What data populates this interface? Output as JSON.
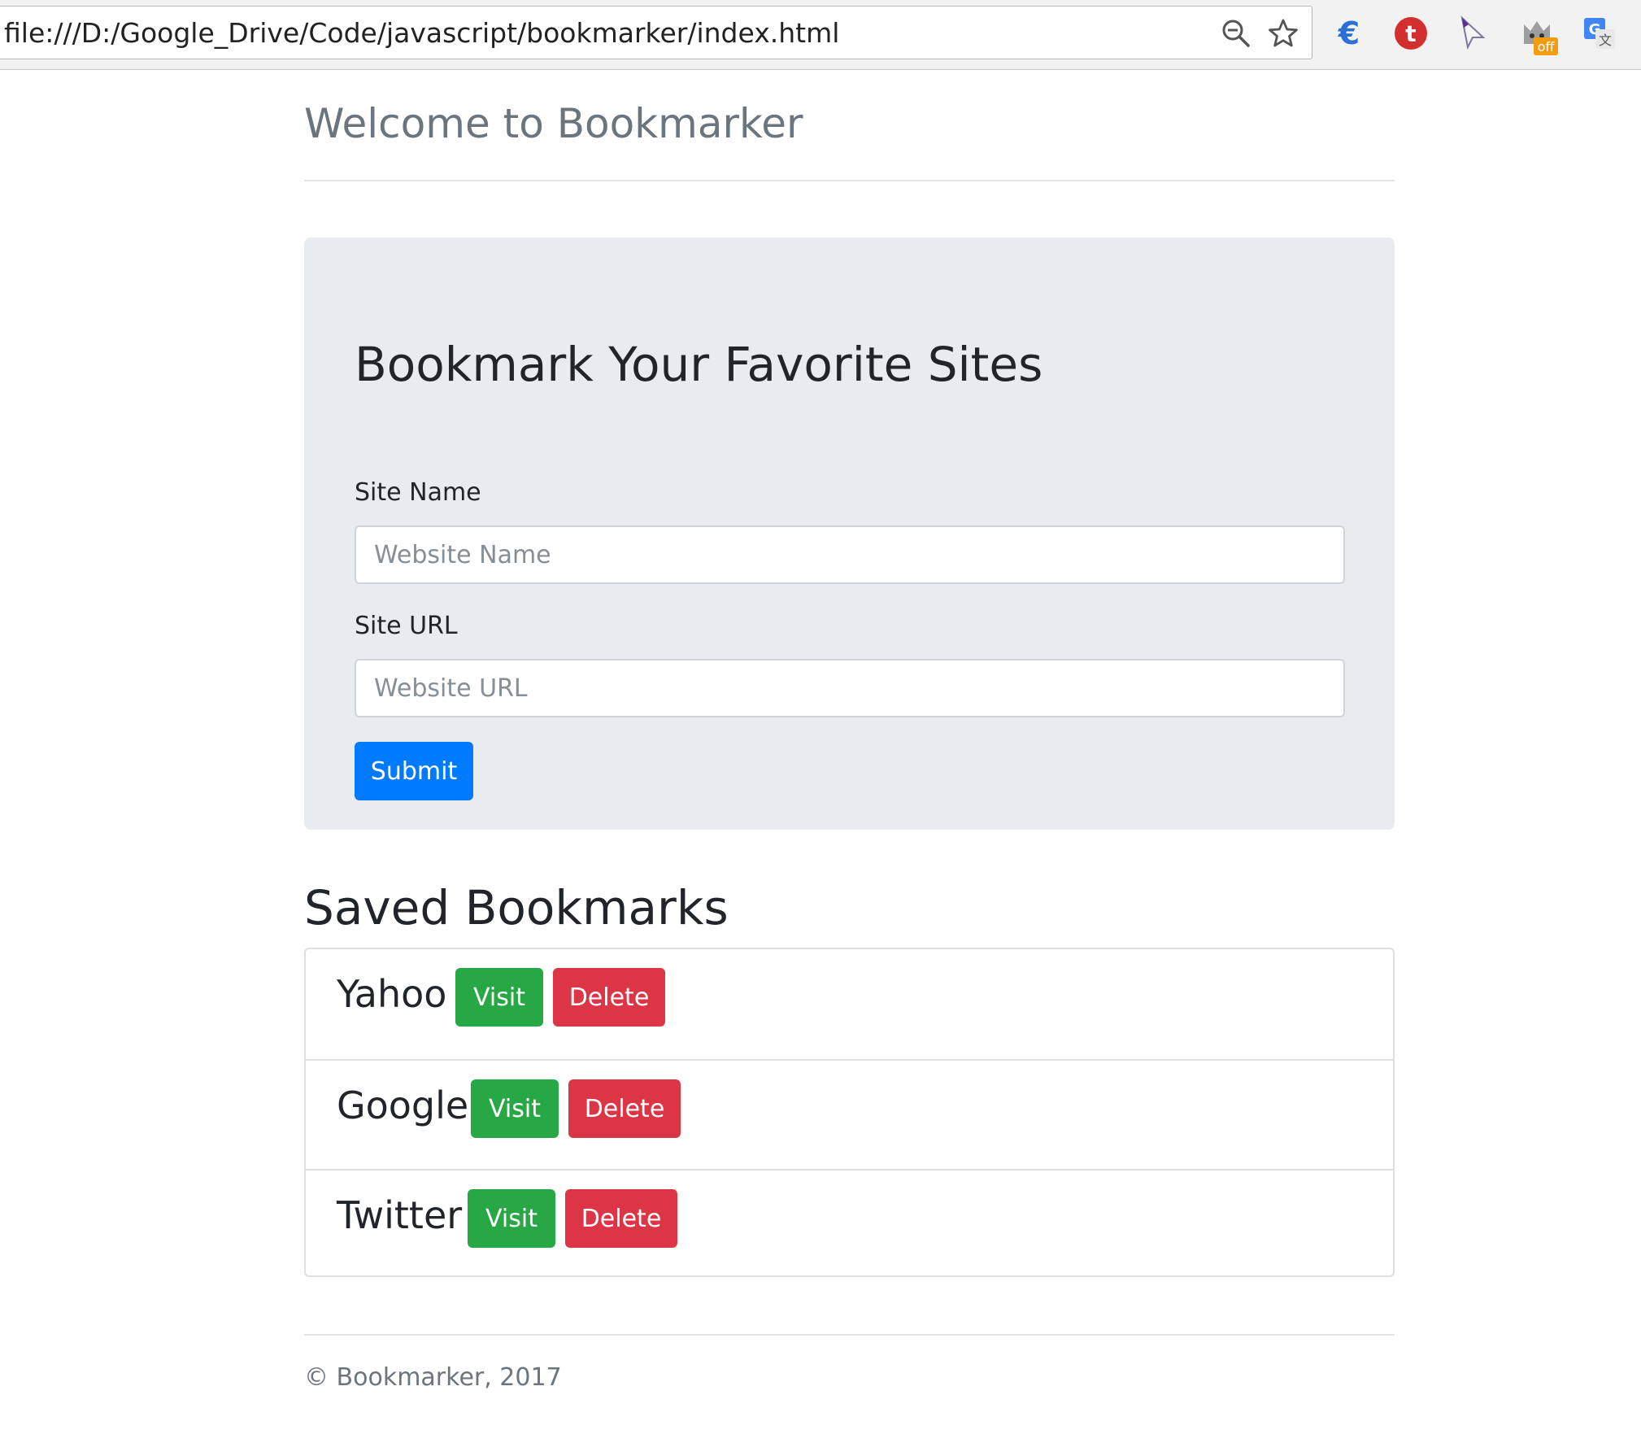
{
  "browser": {
    "url": "file:///D:/Google_Drive/Code/javascript/bookmarker/index.html",
    "zoom_icon": "zoom-out-magnifier-icon",
    "bookmark_icon": "star-icon",
    "extensions": [
      {
        "icon": "euro-extension-icon"
      },
      {
        "icon": "t-extension-icon"
      },
      {
        "icon": "cursor-extension-icon"
      },
      {
        "icon": "cat-extension-icon",
        "badge": "off"
      },
      {
        "icon": "translate-extension-icon"
      }
    ]
  },
  "header": {
    "title": "Welcome to Bookmarker"
  },
  "form": {
    "heading": "Bookmark Your Favorite Sites",
    "site_name_label": "Site Name",
    "site_name_placeholder": "Website Name",
    "site_url_label": "Site URL",
    "site_url_placeholder": "Website URL",
    "submit_label": "Submit"
  },
  "bookmarks": {
    "heading": "Saved Bookmarks",
    "items": [
      {
        "name": "Yahoo",
        "visit_label": "Visit",
        "delete_label": "Delete"
      },
      {
        "name": "Google",
        "visit_label": "Visit",
        "delete_label": "Delete"
      },
      {
        "name": "Twitter",
        "visit_label": "Visit",
        "delete_label": "Delete"
      }
    ]
  },
  "footer": {
    "text": "© Bookmarker, 2017"
  },
  "colors": {
    "primary": "#007bff",
    "success": "#28a745",
    "danger": "#dc3545",
    "jumbotron": "#e9ecef",
    "muted": "#6c757d"
  }
}
